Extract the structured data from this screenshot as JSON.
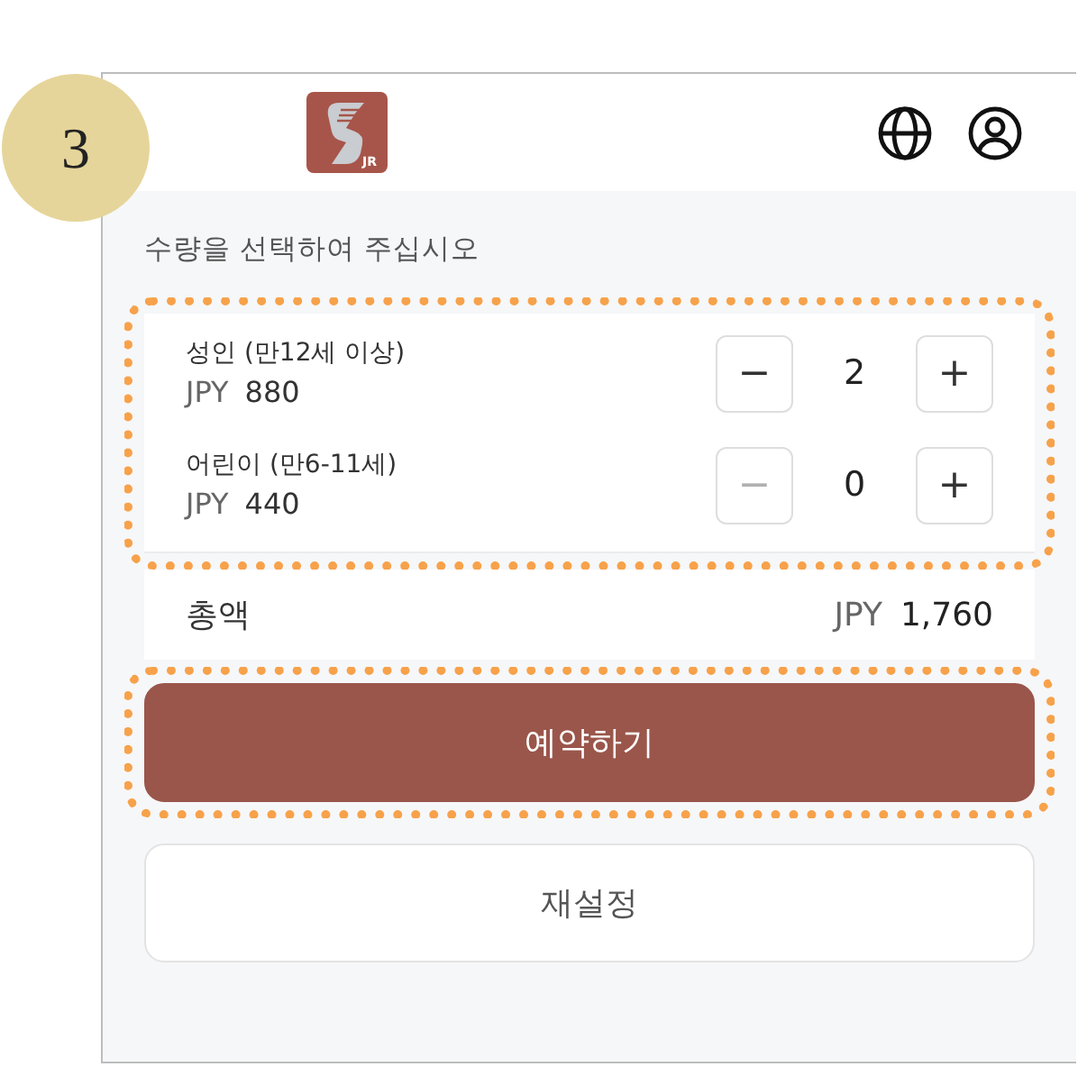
{
  "step_badge": "3",
  "header": {
    "logo_text": "JR"
  },
  "prompt": "수량을 선택하여 주십시오",
  "passengers": [
    {
      "label": "성인 (만12세 이상)",
      "currency": "JPY",
      "price": "880",
      "count": "2",
      "minus_symbol": "−",
      "plus_symbol": "+",
      "minus_disabled": false
    },
    {
      "label": "어린이 (만6-11세)",
      "currency": "JPY",
      "price": "440",
      "count": "0",
      "minus_symbol": "−",
      "plus_symbol": "+",
      "minus_disabled": true
    }
  ],
  "quantity_section": {
    "highlighted": true
  },
  "total": {
    "label": "총액",
    "currency": "JPY",
    "amount": "1,760"
  },
  "buttons": [
    {
      "label": "예약하기",
      "kind": "primary",
      "highlighted": true
    },
    {
      "label": "재설정",
      "kind": "secondary",
      "highlighted": false
    }
  ]
}
